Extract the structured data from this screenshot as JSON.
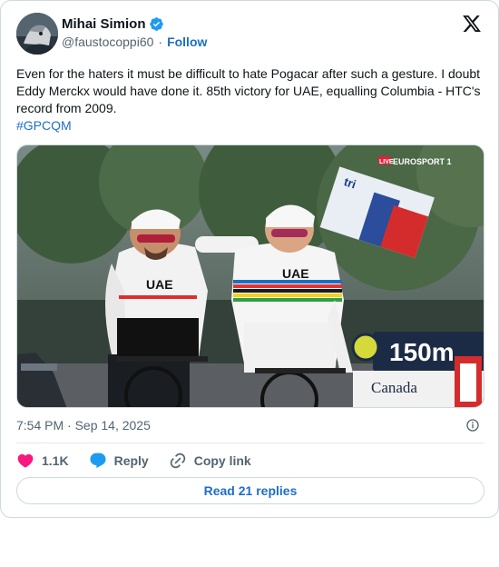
{
  "author": {
    "display_name": "Mihai Simion",
    "handle": "@faustocoppi60",
    "separator": "·",
    "follow_label": "Follow",
    "verified_color": "#1d9bf0"
  },
  "post": {
    "text": "Even for the haters it must be difficult to hate Pogacar after such a gesture. I doubt Eddy Merckx would have done it. 85th victory for UAE, equalling Columbia - HTC's record from 2009.",
    "hashtag": "#GPCQM",
    "timestamp": "7:54 PM · Sep 14, 2025"
  },
  "media": {
    "broadcast_live": "LIVE",
    "broadcast_channel": "EUROSPORT 1",
    "distance_marker": "150m",
    "sponsor_banner": "Canada",
    "jersey_text_left": "UAE",
    "jersey_text_right": "UAE"
  },
  "actions": {
    "likes": "1.1K",
    "reply_label": "Reply",
    "copy_link_label": "Copy link",
    "like_color": "#f91880",
    "reply_color": "#1d9bf0"
  },
  "read_replies_label": "Read 21 replies",
  "icons": [
    "verified-badge-icon",
    "x-logo-icon",
    "info-icon",
    "heart-icon",
    "reply-bubble-icon",
    "link-icon"
  ]
}
